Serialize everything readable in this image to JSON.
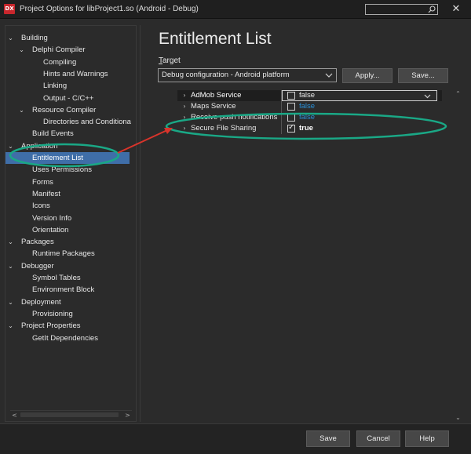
{
  "window": {
    "icon_text": "DX",
    "title": "Project Options for libProject1.so  (Android - Debug)",
    "close_glyph": "✕"
  },
  "tree": {
    "items": [
      {
        "label": "Building",
        "level": 0,
        "expanded": true
      },
      {
        "label": "Delphi Compiler",
        "level": 1,
        "expanded": true
      },
      {
        "label": "Compiling",
        "level": 2
      },
      {
        "label": "Hints and Warnings",
        "level": 2
      },
      {
        "label": "Linking",
        "level": 2
      },
      {
        "label": "Output - C/C++",
        "level": 2
      },
      {
        "label": "Resource Compiler",
        "level": 1,
        "expanded": true
      },
      {
        "label": "Directories and Conditiona",
        "level": 2
      },
      {
        "label": "Build Events",
        "level": 1
      },
      {
        "label": "Application",
        "level": 0,
        "expanded": true
      },
      {
        "label": "Entitlement List",
        "level": 1,
        "selected": true
      },
      {
        "label": "Uses Permissions",
        "level": 1
      },
      {
        "label": "Forms",
        "level": 1
      },
      {
        "label": "Manifest",
        "level": 1
      },
      {
        "label": "Icons",
        "level": 1
      },
      {
        "label": "Version Info",
        "level": 1
      },
      {
        "label": "Orientation",
        "level": 1
      },
      {
        "label": "Packages",
        "level": 0,
        "expanded": true
      },
      {
        "label": "Runtime Packages",
        "level": 1
      },
      {
        "label": "Debugger",
        "level": 0,
        "expanded": true
      },
      {
        "label": "Symbol Tables",
        "level": 1
      },
      {
        "label": "Environment Block",
        "level": 1
      },
      {
        "label": "Deployment",
        "level": 0,
        "expanded": true
      },
      {
        "label": "Provisioning",
        "level": 1
      },
      {
        "label": "Project Properties",
        "level": 0,
        "expanded": true
      },
      {
        "label": "GetIt Dependencies",
        "level": 1
      }
    ]
  },
  "main": {
    "title": "Entitlement List",
    "target_label_accel": "T",
    "target_label_rest": "arget",
    "target_value": "Debug configuration - Android platform",
    "apply_label": "Apply...",
    "save_label": "Save..."
  },
  "entitlements": [
    {
      "name": "AdMob Service",
      "value": "false",
      "checked": false,
      "selected": true
    },
    {
      "name": "Maps Service",
      "value": "false",
      "checked": false
    },
    {
      "name": "Receive push notifications",
      "value": "false",
      "checked": false
    },
    {
      "name": "Secure File Sharing",
      "value": "true",
      "checked": true
    }
  ],
  "footer": {
    "ok_label": "Save",
    "cancel_label": "Cancel",
    "help_label": "Help"
  },
  "colors": {
    "link_false": "#2a8fd6",
    "annotation_ellipse": "#1aa886",
    "annotation_arrow": "#d9342b",
    "selection": "#3f6ea8"
  }
}
